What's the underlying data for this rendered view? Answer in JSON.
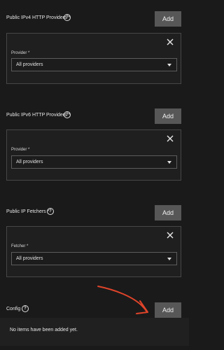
{
  "colors": {
    "background": "#1a1a1a",
    "card_border": "#474747",
    "button_bg": "#575757",
    "annotation": "#e0442a"
  },
  "ipv4_providers": {
    "label": "Public IPv4 HTTP Providers *",
    "help_icon": "help-circle-icon",
    "add_label": "Add",
    "close_icon": "close-icon",
    "field_label": "Provider *",
    "select_value": "All providers"
  },
  "ipv6_providers": {
    "label": "Public IPv6 HTTP Providers *",
    "help_icon": "help-circle-icon",
    "add_label": "Add",
    "close_icon": "close-icon",
    "field_label": "Provider *",
    "select_value": "All providers"
  },
  "ip_fetchers": {
    "label": "Public IP Fetchers *",
    "help_icon": "help-circle-icon",
    "add_label": "Add",
    "close_icon": "close-icon",
    "field_label": "Fetcher *",
    "select_value": "All providers"
  },
  "config": {
    "label": "Config",
    "help_icon": "help-circle-icon",
    "add_label": "Add",
    "empty_text": "No items have been added yet."
  },
  "annotation": {
    "icon": "hand-drawn-arrow-icon"
  }
}
